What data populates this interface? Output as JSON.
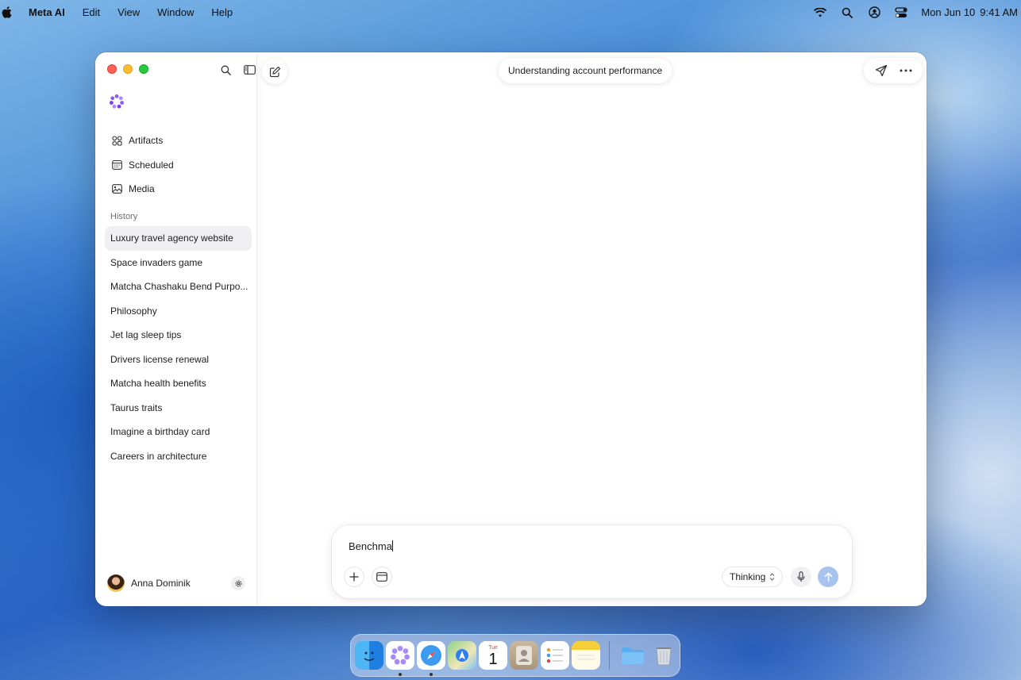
{
  "menubar": {
    "app_name": "Meta AI",
    "items": [
      "Edit",
      "View",
      "Window",
      "Help"
    ],
    "date": "Mon Jun 10",
    "time": "9:41 AM"
  },
  "window": {
    "conversation_title": "Understanding account performance"
  },
  "sidebar": {
    "nav": [
      {
        "label": "Artifacts",
        "icon": "artifacts-icon"
      },
      {
        "label": "Scheduled",
        "icon": "calendar-icon"
      },
      {
        "label": "Media",
        "icon": "image-icon"
      }
    ],
    "history_label": "History",
    "history": [
      "Luxury travel agency website",
      "Space invaders game",
      "Matcha Chashaku Bend Purpo...",
      "Philosophy",
      "Jet lag sleep tips",
      "Drivers license renewal",
      "Matcha health benefits",
      "Taurus traits",
      "Imagine a birthday card",
      "Careers in architecture"
    ],
    "user_name": "Anna Dominik"
  },
  "composer": {
    "value": "Benchma",
    "mode": "Thinking"
  },
  "dock": {
    "calendar_month": "Tue",
    "calendar_day": "1"
  },
  "colors": {
    "close": "#fe5f57",
    "minimize": "#febc2e",
    "maximize": "#28c840",
    "send_disabled": "#a9c3ef",
    "meta_logo": "#8b5cf6"
  }
}
